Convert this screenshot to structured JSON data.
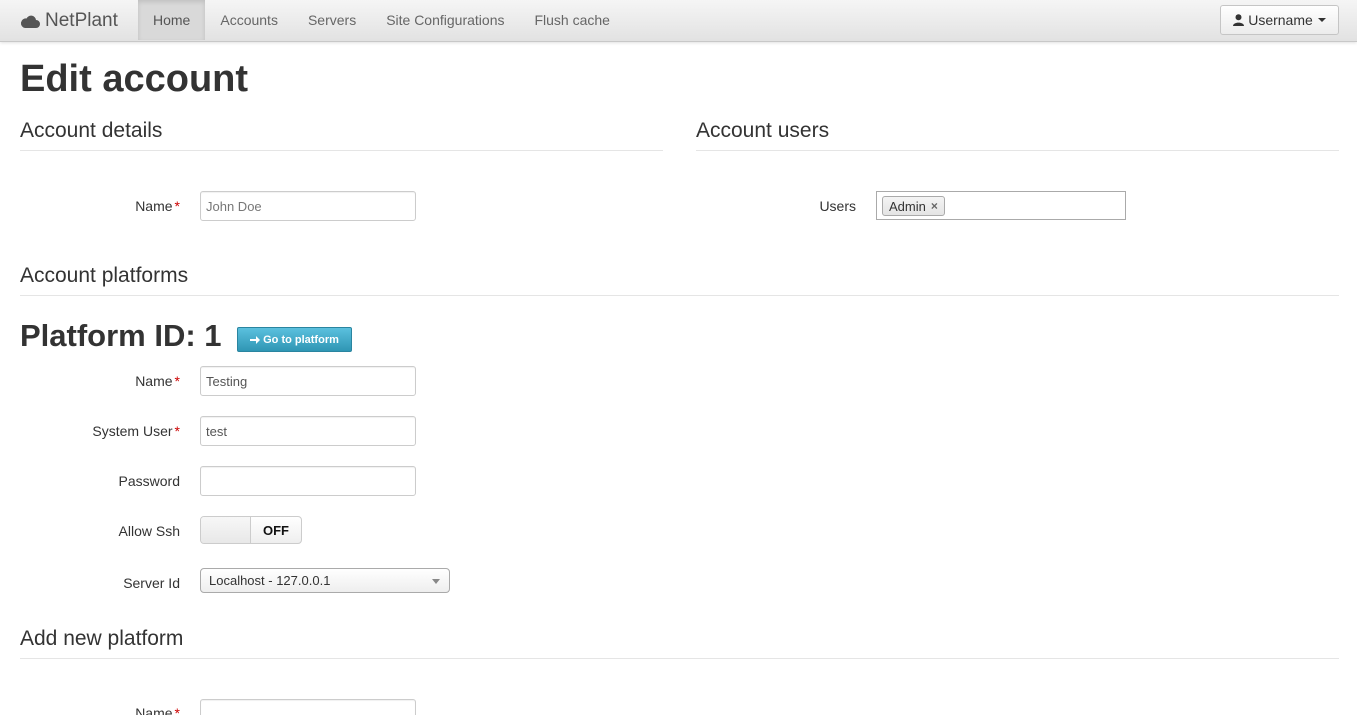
{
  "navbar": {
    "brand": "NetPlant",
    "items": [
      {
        "label": "Home",
        "active": true
      },
      {
        "label": "Accounts",
        "active": false
      },
      {
        "label": "Servers",
        "active": false
      },
      {
        "label": "Site Configurations",
        "active": false
      },
      {
        "label": "Flush cache",
        "active": false
      }
    ],
    "user_menu": "Username"
  },
  "page": {
    "title": "Edit account"
  },
  "account_details": {
    "heading": "Account details",
    "name_label": "Name",
    "name_value": "John Doe",
    "required_mark": "*"
  },
  "account_users": {
    "heading": "Account users",
    "users_label": "Users",
    "tags": [
      "Admin"
    ],
    "remove_glyph": "×"
  },
  "account_platforms": {
    "heading": "Account platforms",
    "platform_title": "Platform ID: 1",
    "goto_button": "Go to platform",
    "fields": {
      "name_label": "Name",
      "name_value": "Testing",
      "system_user_label": "System User",
      "system_user_value": "test",
      "password_label": "Password",
      "password_value": "",
      "allow_ssh_label": "Allow Ssh",
      "allow_ssh_state": "OFF",
      "server_id_label": "Server Id",
      "server_id_value": "Localhost - 127.0.0.1"
    }
  },
  "add_platform": {
    "heading": "Add new platform",
    "name_label": "Name",
    "name_value": ""
  },
  "colors": {
    "accent": "#2f96b4",
    "required": "#cc0000"
  }
}
